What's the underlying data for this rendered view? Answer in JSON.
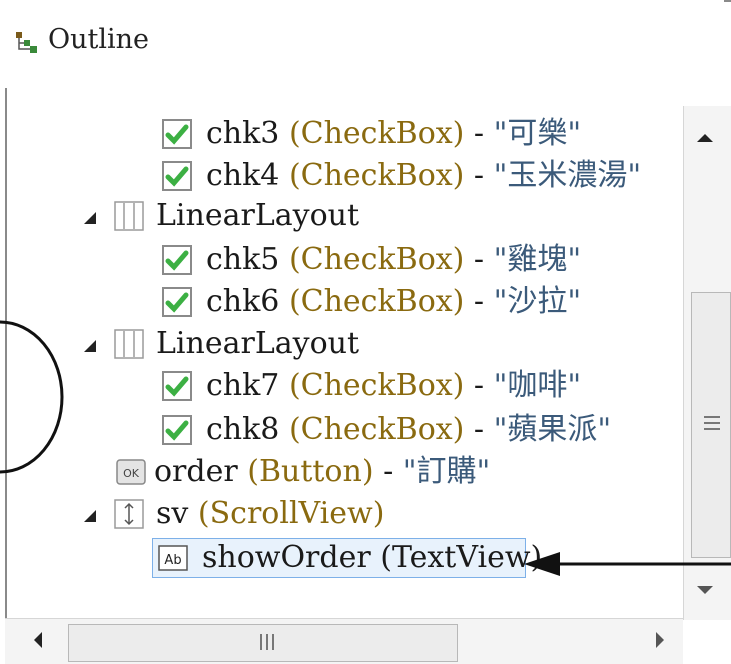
{
  "window": {
    "title": "Outline",
    "title_icon": "outline-tree-icon"
  },
  "tree": {
    "rows": [
      {
        "id": "chk3",
        "type": "(CheckBox)",
        "sep": " - ",
        "text": "\"可樂\"",
        "icon": "checkbox-icon"
      },
      {
        "id": "chk4",
        "type": "(CheckBox)",
        "sep": " - ",
        "text": "\"玉米濃湯\"",
        "icon": "checkbox-icon"
      },
      {
        "id": "LinearLayout",
        "type": "",
        "sep": "",
        "text": "",
        "icon": "linear-layout-icon",
        "expanded": true
      },
      {
        "id": "chk5",
        "type": "(CheckBox)",
        "sep": " - ",
        "text": "\"雞塊\"",
        "icon": "checkbox-icon"
      },
      {
        "id": "chk6",
        "type": "(CheckBox)",
        "sep": " - ",
        "text": "\"沙拉\"",
        "icon": "checkbox-icon"
      },
      {
        "id": "LinearLayout",
        "type": "",
        "sep": "",
        "text": "",
        "icon": "linear-layout-icon",
        "expanded": true
      },
      {
        "id": "chk7",
        "type": "(CheckBox)",
        "sep": " - ",
        "text": "\"咖啡\"",
        "icon": "checkbox-icon"
      },
      {
        "id": "chk8",
        "type": "(CheckBox)",
        "sep": " - ",
        "text": "\"蘋果派\"",
        "icon": "checkbox-icon"
      },
      {
        "id": "order",
        "type": "(Button)",
        "sep": " - ",
        "text": "\"訂購\"",
        "icon": "button-icon"
      },
      {
        "id": "sv",
        "type": "(ScrollView)",
        "sep": "",
        "text": "",
        "icon": "scrollview-icon",
        "expanded": true
      },
      {
        "id": "showOrder",
        "type": "(TextView)",
        "sep": "",
        "text": "",
        "icon": "textview-icon",
        "selected": true
      }
    ]
  },
  "colors": {
    "type_color": "#8a6a10",
    "text_color": "#3b5a7a",
    "selection": "#e8f2fc",
    "checkbox_green": "#3cb043"
  }
}
